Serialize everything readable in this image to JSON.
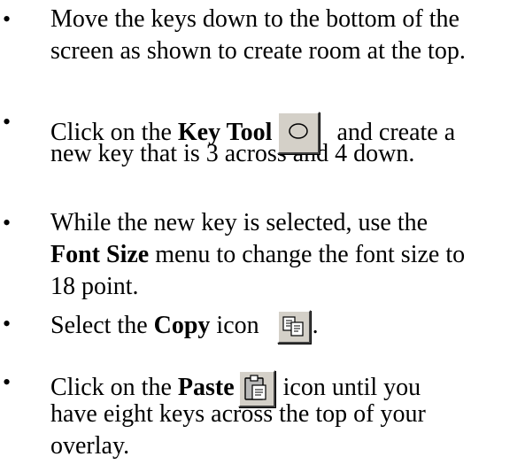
{
  "steps": [
    {
      "bullet": "•",
      "lines": [
        "Move the keys down to the bottom of the",
        "screen as shown to create room at the top."
      ]
    },
    {
      "bullet": "•",
      "pre": "Click on the ",
      "bold": "Key Tool",
      "post": " and create a",
      "line2": "new key that is 3 across and 4 down.",
      "icon": "key-tool-icon"
    },
    {
      "bullet": "•",
      "line1": "While the new key is selected, use the",
      "bold": "Font Size",
      "post": " menu to change the font size to",
      "line3": "18 point."
    },
    {
      "bullet": "•",
      "pre": "Select the ",
      "bold": "Copy",
      "post": " icon",
      "tail": ".",
      "icon": "copy-icon"
    },
    {
      "bullet": "•",
      "pre": "Click on the ",
      "bold": "Paste",
      "post": " icon until you",
      "line2": "have eight keys across the top of your",
      "line3": "overlay.",
      "icon": "paste-icon"
    }
  ]
}
